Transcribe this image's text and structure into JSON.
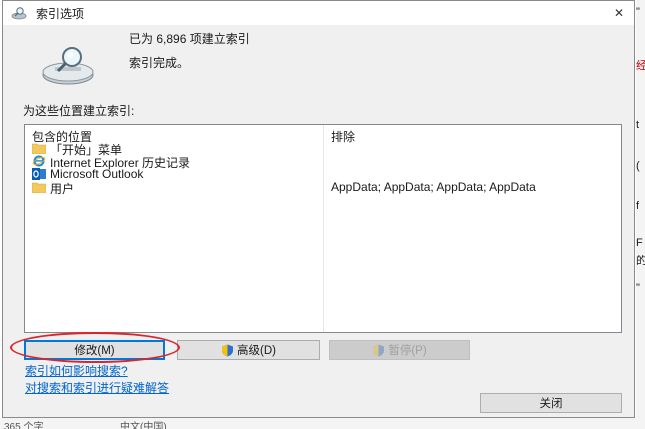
{
  "window": {
    "title": "索引选项",
    "close_glyph": "✕"
  },
  "status": {
    "count_text": "已为 6,896 项建立索引",
    "state_text": "索引完成。"
  },
  "locations": {
    "section_label": "为这些位置建立索引:",
    "columns": {
      "included": "包含的位置",
      "exclude": "排除"
    },
    "rows": [
      {
        "name": "「开始」菜单",
        "icon": "folder-icon",
        "exclude": ""
      },
      {
        "name": "Internet Explorer 历史记录",
        "icon": "internet-explorer-icon",
        "exclude": ""
      },
      {
        "name": "Microsoft Outlook",
        "icon": "outlook-icon",
        "exclude": ""
      },
      {
        "name": "用户",
        "icon": "folder-icon",
        "exclude": "AppData; AppData; AppData; AppData"
      }
    ]
  },
  "buttons": {
    "modify": "修改(M)",
    "advanced": "高级(D)",
    "pause": "暂停(P)",
    "close": "关闭"
  },
  "links": {
    "how_index_affects": "索引如何影响搜索?",
    "troubleshoot": "对搜索和索引进行疑难解答"
  },
  "background": {
    "edge_chars": [
      "\"",
      "经",
      "t",
      "(",
      "f",
      "F",
      "的",
      "\""
    ],
    "bottom_left": "365 个字",
    "bottom_mid": "中文(中国)"
  },
  "colors": {
    "annotation_ellipse": "#d9262c",
    "link": "#0066cc",
    "focus": "#0078d7"
  }
}
